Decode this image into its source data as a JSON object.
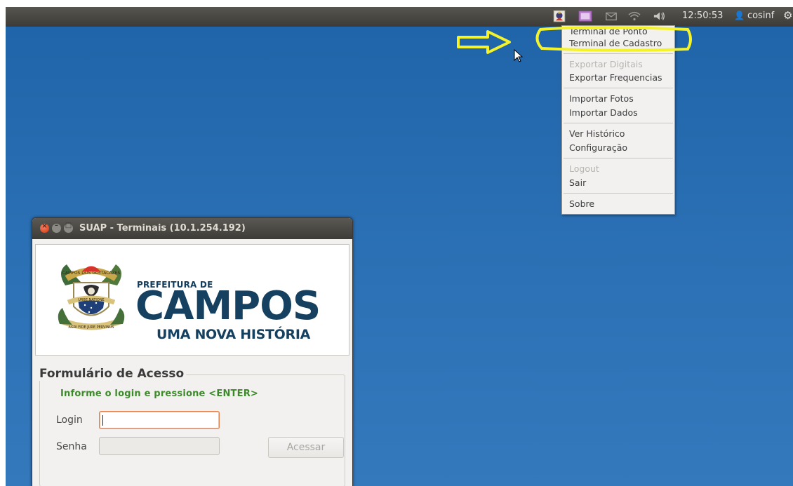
{
  "topbar": {
    "clock": "12:50:53",
    "user": "cosinf",
    "icons": [
      "app-indicator-icon",
      "calendar-icon",
      "mail-icon",
      "wifi-icon",
      "volume-icon",
      "user-icon",
      "power-icon"
    ]
  },
  "menu": {
    "items": [
      {
        "label": "Terminal de Ponto",
        "enabled": true
      },
      {
        "label": "Terminal de Cadastro",
        "enabled": true,
        "highlighted": true
      },
      {
        "label": "Exportar Digitais",
        "enabled": false
      },
      {
        "label": "Exportar Frequencias",
        "enabled": true
      },
      {
        "label": "Importar Fotos",
        "enabled": true
      },
      {
        "label": "Importar Dados",
        "enabled": true
      },
      {
        "label": "Ver Histórico",
        "enabled": true
      },
      {
        "label": "Configuração",
        "enabled": true
      },
      {
        "label": "Logout",
        "enabled": false
      },
      {
        "label": "Sair",
        "enabled": true
      },
      {
        "label": "Sobre",
        "enabled": true
      }
    ]
  },
  "annotation": {
    "arrow_color": "#f4f22a",
    "highlight_color": "#f4f22a"
  },
  "window": {
    "title": "SUAP - Terminais (10.1.254.192)",
    "logo": {
      "line1": "PREFEITURA DE",
      "line2": "CAMPOS",
      "line3": "UMA NOVA HISTÓRIA",
      "crest_banner_top": "CAMPOS DOS GOYTACAZES",
      "crest_banner_mid": "URBE NATIONE",
      "crest_banner_bottom": "AGRI FIDE JURE PERVINUS"
    },
    "form": {
      "legend": "Formulário de Acesso",
      "hint": "Informe o login e pressione <ENTER>",
      "login_label": "Login",
      "login_value": "",
      "senha_label": "Senha",
      "senha_value": "",
      "submit_label": "Acessar"
    }
  },
  "colors": {
    "desktop": "#2a6fb3",
    "topbar": "#3c3b37",
    "logo_blue": "#15405f",
    "hint_green": "#3d8a2a",
    "focus_border": "#e0804a"
  }
}
